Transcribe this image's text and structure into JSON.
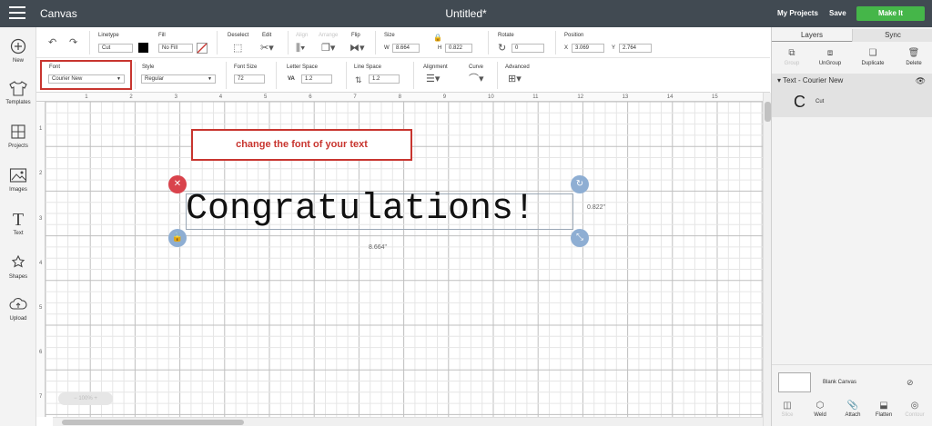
{
  "topbar": {
    "brand": "Canvas",
    "doc_title": "Untitled*",
    "my_projects": "My Projects",
    "save": "Save",
    "make_it": "Make It"
  },
  "sidebar": {
    "items": [
      {
        "label": "New",
        "icon": "plus-circle-icon"
      },
      {
        "label": "Templates",
        "icon": "shirt-icon"
      },
      {
        "label": "Projects",
        "icon": "grid-icon"
      },
      {
        "label": "Images",
        "icon": "image-icon"
      },
      {
        "label": "Text",
        "icon": "text-icon"
      },
      {
        "label": "Shapes",
        "icon": "shapes-icon"
      },
      {
        "label": "Upload",
        "icon": "cloud-upload-icon"
      }
    ]
  },
  "toolbar1": {
    "linetype_label": "Linetype",
    "linetype_value": "Cut",
    "fill_label": "Fill",
    "fill_value": "No Fill",
    "deselect_label": "Deselect",
    "edit_label": "Edit",
    "align_label": "Align",
    "arrange_label": "Arrange",
    "flip_label": "Flip",
    "size_label": "Size",
    "w_label": "W",
    "w_value": "8.664",
    "h_label": "H",
    "h_value": "0.822",
    "rotate_label": "Rotate",
    "rotate_value": "0",
    "position_label": "Position",
    "x_label": "X",
    "x_value": "3.069",
    "y_label": "Y",
    "y_value": "2.764",
    "swatch_color": "#000000"
  },
  "toolbar2": {
    "font_label": "Font",
    "font_value": "Courier New",
    "style_label": "Style",
    "style_value": "Regular",
    "font_size_label": "Font Size",
    "font_size_value": "72",
    "letter_space_label": "Letter Space",
    "letter_space_prefix": "VA",
    "letter_space_value": "1.2",
    "line_space_label": "Line Space",
    "line_space_value": "1.2",
    "alignment_label": "Alignment",
    "curve_label": "Curve",
    "advanced_label": "Advanced"
  },
  "canvas": {
    "ruler_h": [
      "1",
      "2",
      "3",
      "4",
      "5",
      "6",
      "7",
      "8",
      "9",
      "10",
      "11",
      "12",
      "13",
      "14",
      "15"
    ],
    "ruler_v": [
      "1",
      "2",
      "3",
      "4",
      "5",
      "6",
      "7"
    ],
    "callout": "change the font of your text",
    "text": "Congratulations!",
    "height_dim": "0.822\"",
    "width_dim": "8.664\"",
    "zoom": "100%"
  },
  "panel": {
    "tab_layers": "Layers",
    "tab_sync": "Sync",
    "buttons": [
      "Group",
      "UnGroup",
      "Duplicate",
      "Delete"
    ],
    "layer_title": "Text - Courier New",
    "layer_glyph": "C",
    "layer_sub": "Cut",
    "blank_canvas": "Blank Canvas",
    "bottom_buttons": [
      "Slice",
      "Weld",
      "Attach",
      "Flatten",
      "Contour"
    ]
  },
  "colors": {
    "topbar": "#414a52",
    "make_it": "#45b649",
    "highlight": "#c8352f",
    "delete_handle": "#d9434c",
    "handle": "#8eaed3"
  }
}
